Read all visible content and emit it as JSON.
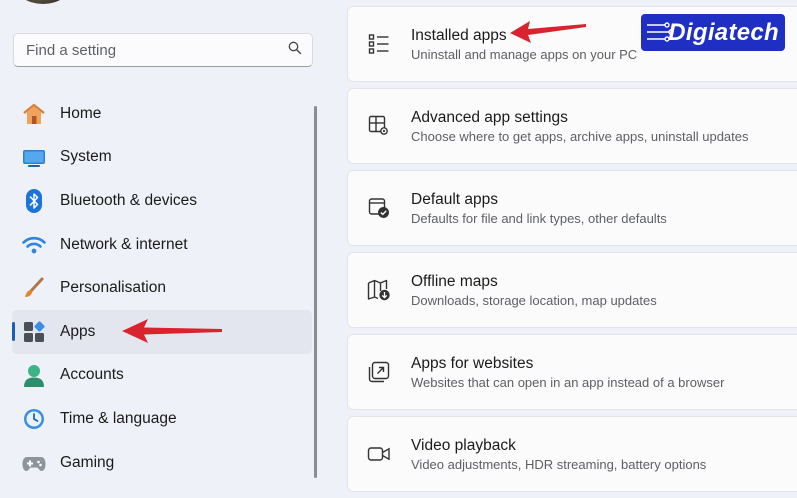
{
  "search": {
    "placeholder": "Find a setting",
    "icon": "search-icon"
  },
  "nav": {
    "items": [
      {
        "label": "Home",
        "icon": "home-icon",
        "active": false
      },
      {
        "label": "System",
        "icon": "system-icon",
        "active": false
      },
      {
        "label": "Bluetooth & devices",
        "icon": "bluetooth-icon",
        "active": false
      },
      {
        "label": "Network & internet",
        "icon": "wifi-icon",
        "active": false
      },
      {
        "label": "Personalisation",
        "icon": "brush-icon",
        "active": false
      },
      {
        "label": "Apps",
        "icon": "apps-icon",
        "active": true
      },
      {
        "label": "Accounts",
        "icon": "accounts-icon",
        "active": false
      },
      {
        "label": "Time & language",
        "icon": "clock-icon",
        "active": false
      },
      {
        "label": "Gaming",
        "icon": "gamepad-icon",
        "active": false
      }
    ]
  },
  "cards": [
    {
      "title": "Installed apps",
      "subtitle": "Uninstall and manage apps on your PC",
      "icon": "installed-apps-icon"
    },
    {
      "title": "Advanced app settings",
      "subtitle": "Choose where to get apps, archive apps, uninstall updates",
      "icon": "advanced-settings-icon"
    },
    {
      "title": "Default apps",
      "subtitle": "Defaults for file and link types, other defaults",
      "icon": "default-apps-icon"
    },
    {
      "title": "Offline maps",
      "subtitle": "Downloads, storage location, map updates",
      "icon": "map-icon"
    },
    {
      "title": "Apps for websites",
      "subtitle": "Websites that can open in an app instead of a browser",
      "icon": "open-external-icon"
    },
    {
      "title": "Video playback",
      "subtitle": "Video adjustments, HDR streaming, battery options",
      "icon": "video-icon"
    }
  ],
  "watermark": {
    "text": "Digiatech"
  },
  "colors": {
    "accent": "#1a5fb4",
    "annotation_arrow": "#d9232e",
    "watermark_bg": "#1f2fc4"
  }
}
